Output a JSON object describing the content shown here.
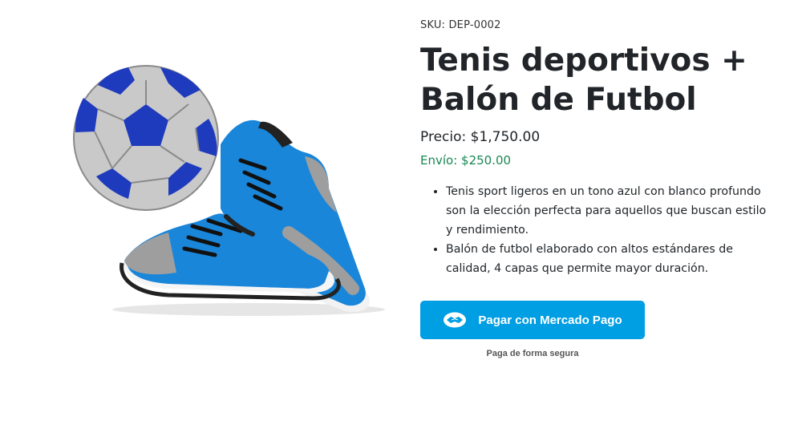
{
  "product": {
    "sku": "SKU: DEP-0002",
    "title": "Tenis deportivos + Balón de Futbol",
    "price": "Precio: $1,750.00",
    "shipping": "Envío: $250.00",
    "features": [
      "Tenis sport ligeros en un tono azul con blanco profundo son la elección perfecta para aquellos que buscan estilo y rendimiento.",
      "Balón de futbol elaborado con altos estándares de calidad, 4 capas que permite mayor duración."
    ],
    "image_icon": "soccer-ball-and-sneakers"
  },
  "payment": {
    "button_label": "Pagar con Mercado Pago",
    "button_icon": "handshake-icon",
    "secure_note": "Paga de forma segura",
    "button_color": "#009ee3"
  },
  "colors": {
    "shipping": "#198754",
    "sneaker_blue": "#1a86d9",
    "ball_blue": "#1f3bbd"
  }
}
